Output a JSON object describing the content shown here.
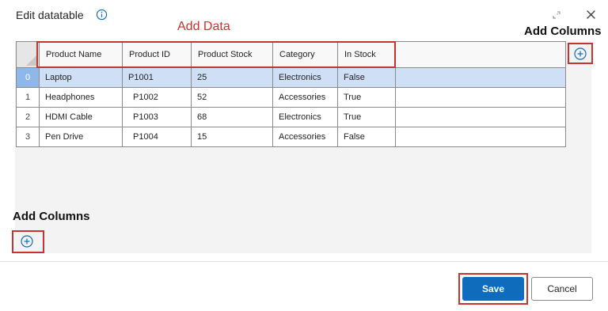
{
  "dialog": {
    "title": "Edit datatable",
    "save_label": "Save",
    "cancel_label": "Cancel"
  },
  "annotations": {
    "add_data": "Add Data",
    "add_columns_right": "Add Columns",
    "add_columns_left": "Add Columns"
  },
  "table": {
    "columns": [
      "Product Name",
      "Product ID",
      "Product Stock",
      "Category",
      "In Stock"
    ],
    "rows": [
      {
        "index": "0",
        "cells": [
          "Laptop",
          "P1001",
          "25",
          "Electronics",
          "False"
        ]
      },
      {
        "index": "1",
        "cells": [
          "Headphones",
          "P1002",
          "52",
          "Accessories",
          "True"
        ]
      },
      {
        "index": "2",
        "cells": [
          "HDMI Cable",
          "P1003",
          "68",
          "Electronics",
          "True"
        ]
      },
      {
        "index": "3",
        "cells": [
          "Pen Drive",
          "P1004",
          "15",
          "Accessories",
          "False"
        ]
      }
    ],
    "selected_row": 0
  },
  "colors": {
    "primary": "#0f6cbd",
    "annotation_red": "#c8332d",
    "selected_row": "#cfe0f6"
  },
  "icons": {
    "info": "info-icon",
    "expand": "expand-icon",
    "close": "close-icon",
    "add_column": "plus-circle-icon",
    "add_row_column": "plus-circle-icon"
  }
}
